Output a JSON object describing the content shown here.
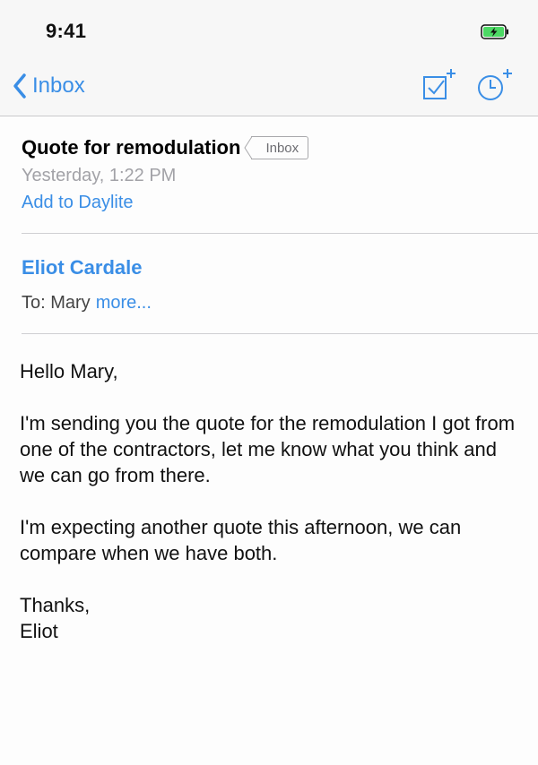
{
  "status_bar": {
    "time": "9:41",
    "battery_icon": "battery-charging-icon"
  },
  "nav": {
    "back_label": "Inbox",
    "back_icon": "chevron-left-icon",
    "actions": [
      "add-task-icon",
      "add-reminder-icon"
    ]
  },
  "message": {
    "subject": "Quote for remodulation",
    "mailbox_tag": "Inbox",
    "date": "Yesterday, 1:22 PM",
    "add_link": "Add to Daylite",
    "sender": "Eliot Cardale",
    "to_label": "To: Mary",
    "more_label": "more...",
    "body": {
      "greeting": "Hello Mary,",
      "paragraph1": "I'm sending you the quote for the remodulation I got from one of the contractors, let me know what you think and we can go from there.",
      "paragraph2": "I'm expecting another quote this afternoon, we can compare when we have both.",
      "signoff": "Thanks,",
      "signature": "Eliot"
    }
  },
  "colors": {
    "accent": "#3a8ee6",
    "battery_fill": "#4cd964",
    "secondary_text": "#a2a2a7",
    "separator": "#cfcfd2"
  }
}
